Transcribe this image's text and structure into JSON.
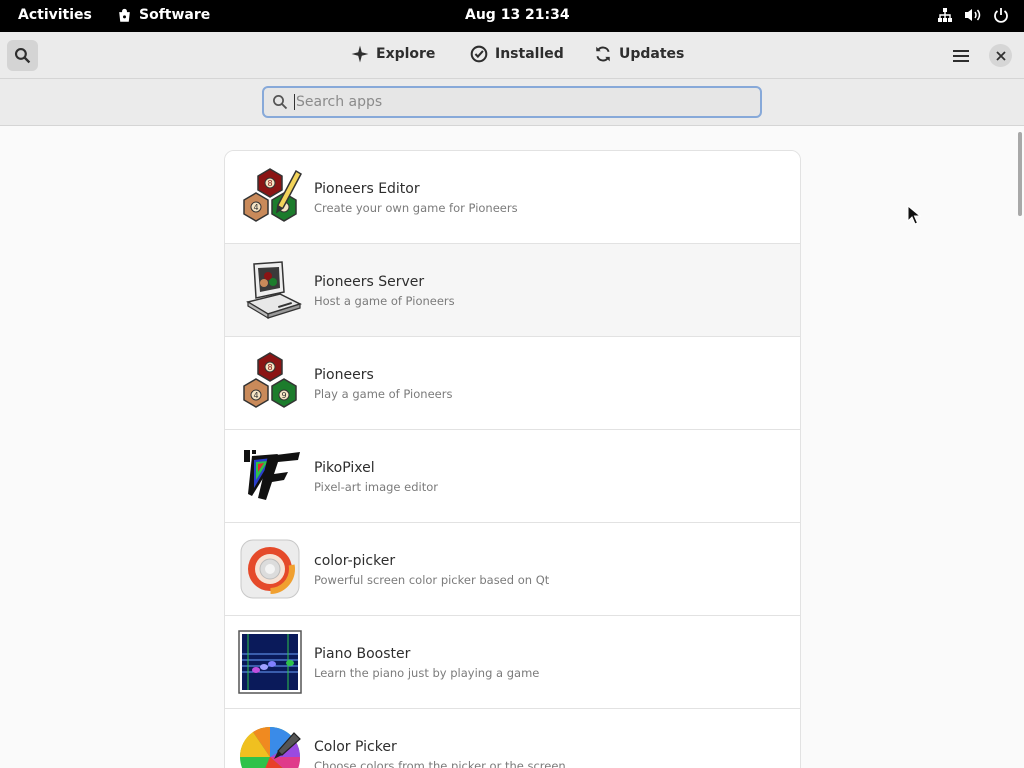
{
  "topbar": {
    "activities": "Activities",
    "app_name": "Software",
    "clock": "Aug 13  21:34",
    "tray_icons": [
      "network-icon",
      "volume-icon",
      "power-icon"
    ]
  },
  "header": {
    "tabs": [
      {
        "label": "Explore",
        "icon": "explore-star-icon"
      },
      {
        "label": "Installed",
        "icon": "check-circle-icon"
      },
      {
        "label": "Updates",
        "icon": "refresh-icon"
      }
    ]
  },
  "search": {
    "placeholder": "Search apps",
    "value": ""
  },
  "apps": [
    {
      "name": "Pioneers Editor",
      "description": "Create your own game for Pioneers",
      "icon": "pioneers-editor-icon"
    },
    {
      "name": "Pioneers Server",
      "description": "Host a game of Pioneers",
      "icon": "pioneers-server-icon"
    },
    {
      "name": "Pioneers",
      "description": "Play a game of Pioneers",
      "icon": "pioneers-icon"
    },
    {
      "name": "PikoPixel",
      "description": "Pixel-art image editor",
      "icon": "pikopixel-icon"
    },
    {
      "name": "color-picker",
      "description": "Powerful screen color picker based on Qt",
      "icon": "color-picker-icon"
    },
    {
      "name": "Piano Booster",
      "description": "Learn the piano just by playing a game",
      "icon": "piano-booster-icon"
    },
    {
      "name": "Color Picker",
      "description": "Choose colors from the picker or the screen",
      "icon": "color-picker-wheel-icon"
    }
  ],
  "colors": {
    "topbar": "#000000",
    "headerbar": "#ebebeb",
    "focus_ring": "#87a9d9",
    "background": "#fafafa"
  }
}
